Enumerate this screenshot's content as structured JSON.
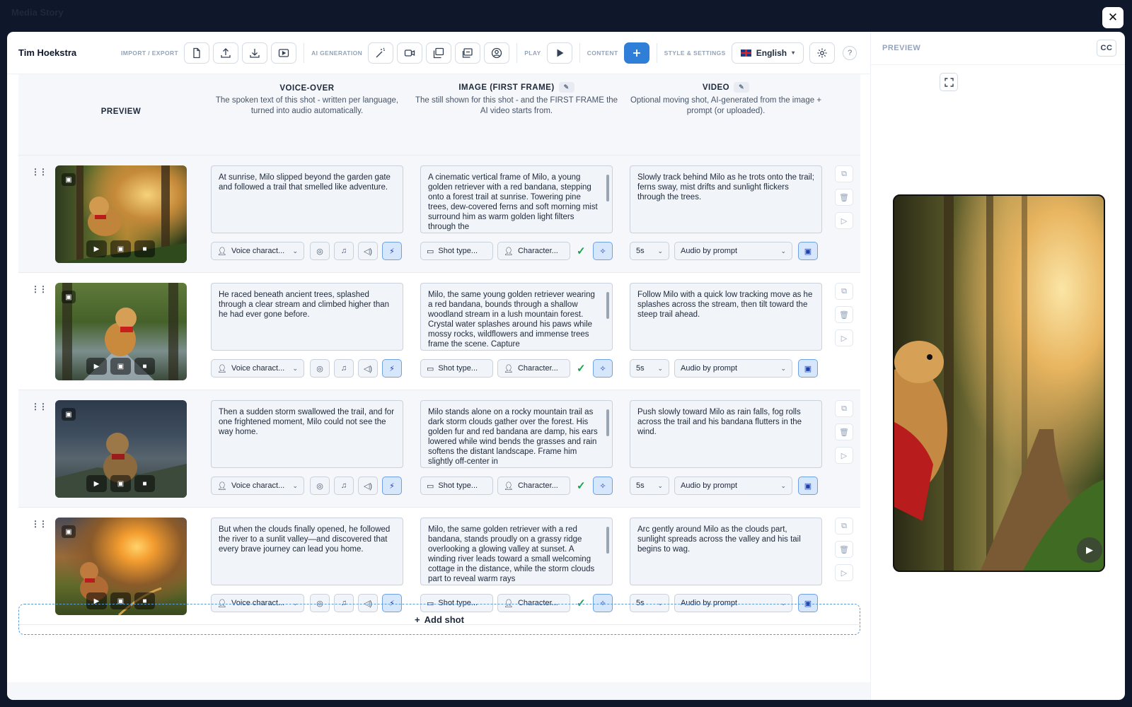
{
  "backdrop_title": "Media Story",
  "toolbar": {
    "user_name": "Tim Hoekstra",
    "import_export_label": "IMPORT / EXPORT",
    "ai_generation_label": "AI GENERATION",
    "play_label": "PLAY",
    "content_label": "CONTENT",
    "style_label": "STYLE & SETTINGS",
    "language": "English",
    "help": "?"
  },
  "columns": {
    "preview": "PREVIEW",
    "voice_over": {
      "title": "VOICE-OVER",
      "desc": "The spoken text of this shot - written per language, turned into audio automatically."
    },
    "image": {
      "title": "IMAGE (FIRST FRAME)",
      "desc": "The still shown for this shot - and the FIRST FRAME the AI video starts from."
    },
    "video": {
      "title": "VIDEO",
      "desc": "Optional moving shot, AI-generated from the image + prompt (or uploaded)."
    }
  },
  "control_labels": {
    "voice": "Voice charact...",
    "shot_type": "Shot type...",
    "character": "Character...",
    "duration": "5s",
    "audio": "Audio by prompt"
  },
  "shots": [
    {
      "voice_over": "At sunrise, Milo slipped beyond the garden gate and followed a trail that smelled like adventure.",
      "image_prompt": "A cinematic vertical frame of Milo, a young golden retriever with a red bandana, stepping onto a forest trail at sunrise. Towering pine trees, dew-covered ferns and soft morning mist surround him as warm golden light filters through the",
      "video_prompt": "Slowly track behind Milo as he trots onto the trail; ferns sway, mist drifts and sunlight flickers through the trees."
    },
    {
      "voice_over": "He raced beneath ancient trees, splashed through a clear stream and climbed higher than he had ever gone before.",
      "image_prompt": "Milo, the same young golden retriever wearing a red bandana, bounds through a shallow woodland stream in a lush mountain forest. Crystal water splashes around his paws while mossy rocks, wildflowers and immense trees frame the scene. Capture",
      "video_prompt": "Follow Milo with a quick low tracking move as he splashes across the stream, then tilt toward the steep trail ahead."
    },
    {
      "voice_over": "Then a sudden storm swallowed the trail, and for one frightened moment, Milo could not see the way home.",
      "image_prompt": "Milo stands alone on a rocky mountain trail as dark storm clouds gather over the forest. His golden fur and red bandana are damp, his ears lowered while wind bends the grasses and rain softens the distant landscape. Frame him slightly off-center in",
      "video_prompt": "Push slowly toward Milo as rain falls, fog rolls across the trail and his bandana flutters in the wind."
    },
    {
      "voice_over": "But when the clouds finally opened, he followed the river to a sunlit valley—and discovered that every brave journey can lead you home.",
      "image_prompt": "Milo, the same golden retriever with a red bandana, stands proudly on a grassy ridge overlooking a glowing valley at sunset. A winding river leads toward a small welcoming cottage in the distance, while the storm clouds part to reveal warm rays",
      "video_prompt": "Arc gently around Milo as the clouds part, sunlight spreads across the valley and his tail begins to wag."
    }
  ],
  "add_shot_label": "Add shot",
  "preview_panel": {
    "title": "PREVIEW",
    "cc": "CC"
  }
}
